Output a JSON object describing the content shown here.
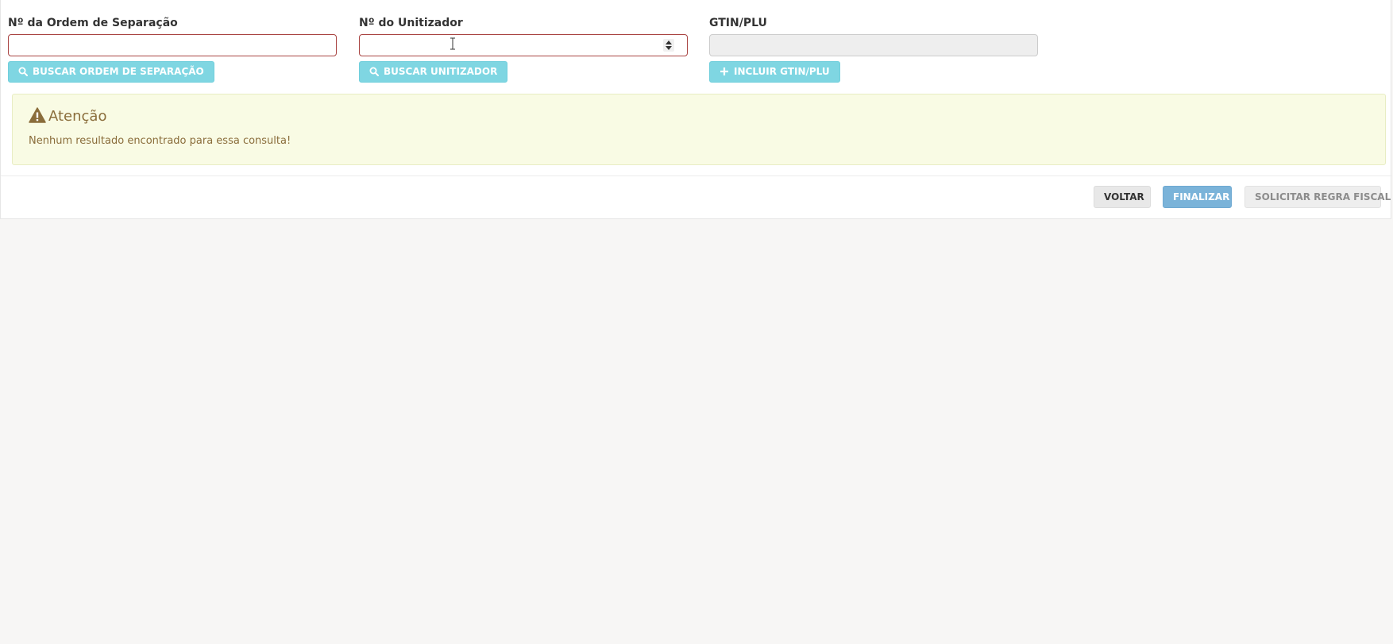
{
  "form": {
    "ordem": {
      "label": "Nº da Ordem de Separação",
      "value": "",
      "button_label": "BUSCAR ORDEM DE SEPARAÇÃO",
      "button_icon": "search-icon"
    },
    "unitizador": {
      "label": "Nº do Unitizador",
      "value": "",
      "button_label": "BUSCAR UNITIZADOR",
      "button_icon": "search-icon"
    },
    "gtin": {
      "label": "GTIN/PLU",
      "value": "",
      "button_label": "INCLUIR GTIN/PLU",
      "button_icon": "plus-icon"
    }
  },
  "alert": {
    "title": "Atenção",
    "message": "Nenhum resultado encontrado para essa consulta!",
    "icon": "warning-icon"
  },
  "footer": {
    "back_label": "VOLTAR",
    "finish_label": "FINALIZAR",
    "fiscal_label": "SOLICITAR REGRA FISCAL"
  },
  "colors": {
    "info_button": "#7fd6e2",
    "error_border": "#a94442",
    "alert_background": "#f9fbe4",
    "alert_text": "#8a6d3b",
    "primary_button": "#7ab3d9"
  }
}
